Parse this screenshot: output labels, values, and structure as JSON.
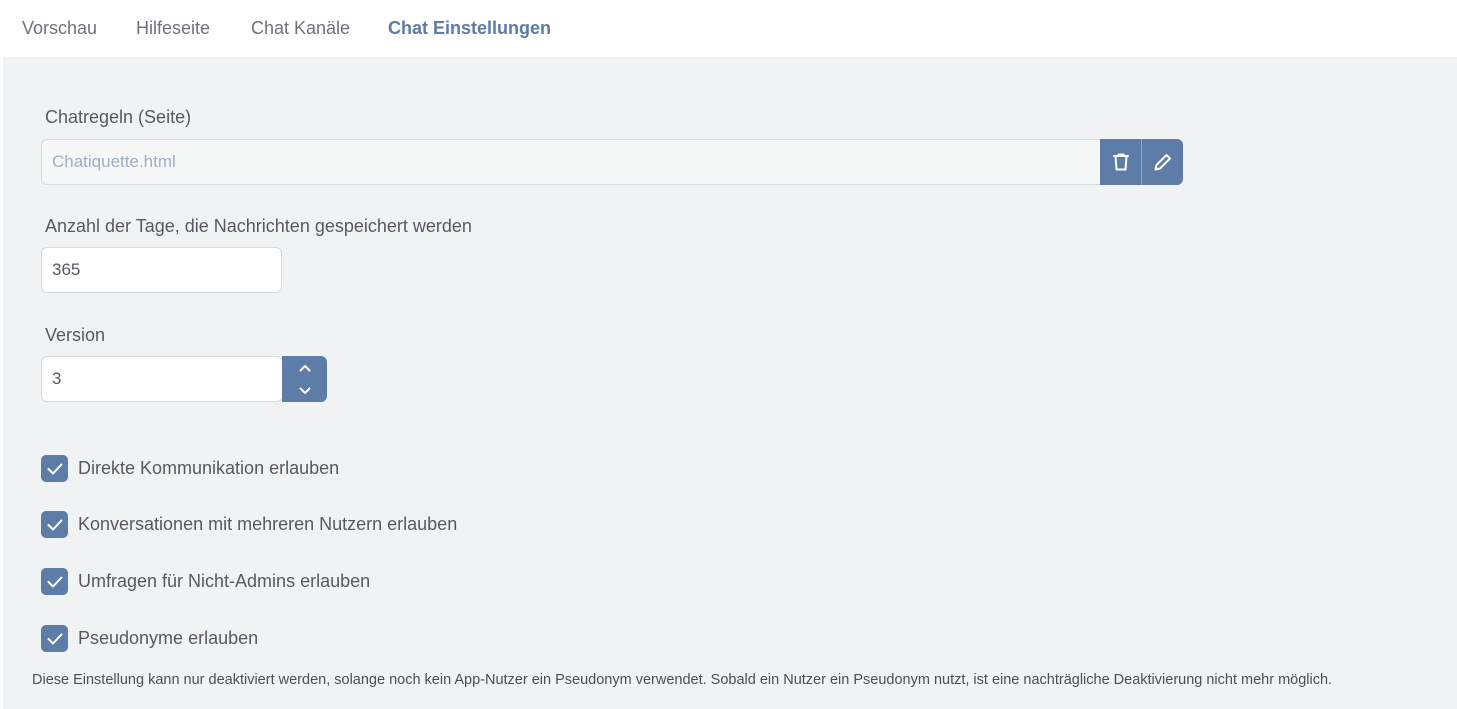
{
  "tabs": [
    {
      "label": "Vorschau",
      "active": false
    },
    {
      "label": "Hilfeseite",
      "active": false
    },
    {
      "label": "Chat Kanäle",
      "active": false
    },
    {
      "label": "Chat Einstellungen",
      "active": true
    }
  ],
  "chat_rules": {
    "label": "Chatregeln (Seite)",
    "value": "Chatiquette.html",
    "delete_icon": "trash-icon",
    "edit_icon": "pencil-icon"
  },
  "retention": {
    "label": "Anzahl der Tage, die Nachrichten gespeichert werden",
    "value": "365"
  },
  "version": {
    "label": "Version",
    "value": "3",
    "up_icon": "chevron-up-icon",
    "down_icon": "chevron-down-icon"
  },
  "options": [
    {
      "label": "Direkte Kommunikation erlauben",
      "checked": true
    },
    {
      "label": "Konversationen mit mehreren Nutzern erlauben",
      "checked": true
    },
    {
      "label": "Umfragen für Nicht-Admins erlauben",
      "checked": true
    },
    {
      "label": "Pseudonyme erlauben",
      "checked": true
    }
  ],
  "pseudonym_note": "Diese Einstellung kann nur deaktiviert werden, solange noch kein App-Nutzer ein Pseudonym verwendet. Sobald ein Nutzer ein Pseudonym nutzt, ist eine nachträgliche Deaktivierung nicht mehr möglich.",
  "colors": {
    "accent": "#5d7ca8",
    "panel_bg": "#f1f2f4",
    "active_tab": "#5b7ba8"
  }
}
